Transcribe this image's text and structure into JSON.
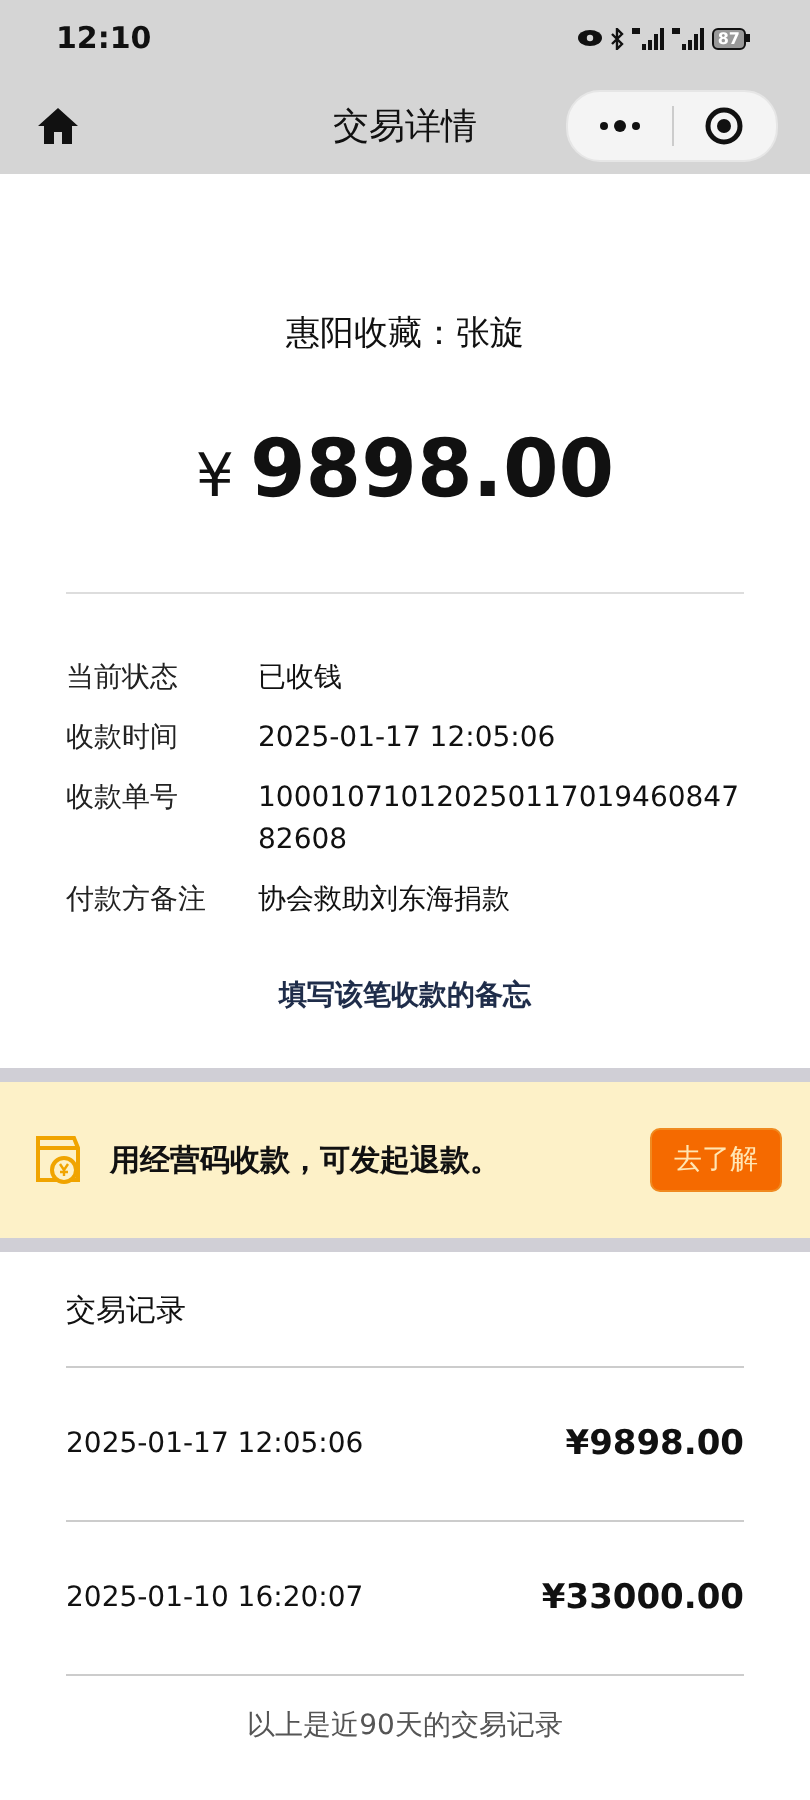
{
  "status_bar": {
    "time": "12:10",
    "battery": "87"
  },
  "nav": {
    "title": "交易详情"
  },
  "payee": "惠阳收藏：张旋",
  "amount": {
    "currency": "¥",
    "value": "9898.00"
  },
  "details": [
    {
      "label": "当前状态",
      "value": "已收钱"
    },
    {
      "label": "收款时间",
      "value": "2025-01-17 12:05:06"
    },
    {
      "label": "收款单号",
      "value": "10001071012025011701946084782608"
    },
    {
      "label": "付款方备注",
      "value": "协会救助刘东海捐款"
    }
  ],
  "note_link": "填写该笔收款的备忘",
  "banner": {
    "text": "用经营码收款，可发起退款。",
    "button": "去了解"
  },
  "records": {
    "title": "交易记录",
    "rows": [
      {
        "time": "2025-01-17 12:05:06",
        "amount": "¥9898.00"
      },
      {
        "time": "2025-01-10 16:20:07",
        "amount": "¥33000.00"
      }
    ],
    "footer": "以上是近90天的交易记录"
  }
}
